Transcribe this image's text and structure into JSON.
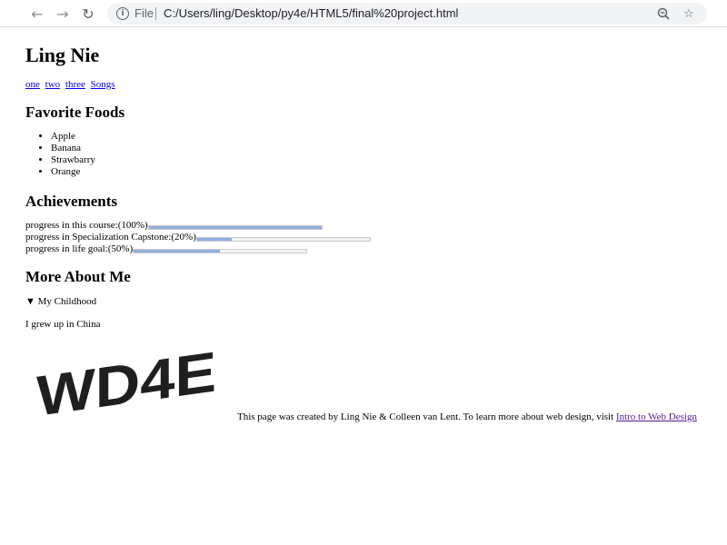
{
  "browser": {
    "scheme_label": "File",
    "url": "C:/Users/ling/Desktop/py4e/HTML5/final%20project.html",
    "back_icon": "arrow-left-icon",
    "forward_icon": "arrow-right-icon",
    "reload_icon": "reload-icon",
    "info_icon": "info-icon",
    "zoom_icon": "zoom-out-icon",
    "star_icon": "star-icon"
  },
  "page": {
    "title": "Ling Nie",
    "nav_links": [
      "one",
      "two",
      "three",
      "Songs"
    ],
    "foods": {
      "heading": "Favorite Foods",
      "items": [
        "Apple",
        "Banana",
        "Strawbarry",
        "Orange"
      ]
    },
    "achievements": {
      "heading": "Achievements",
      "rows": [
        {
          "label": "progress in this course:(100%)",
          "value": 100
        },
        {
          "label": "progress in Specialization Capstone:(20%)",
          "value": 20
        },
        {
          "label": "progress in life goal:(50%)",
          "value": 50
        }
      ]
    },
    "about": {
      "heading": "More About Me",
      "summary": "▼ My Childhood",
      "text": "I grew up in China"
    },
    "logo_text": "WD4E",
    "footer": {
      "text": "This page was created by Ling Nie & Colleen van Lent. To learn more about web design, visit ",
      "link": "Intro to Web Design"
    }
  },
  "colors": {
    "progress_fill": "#8fb0e0",
    "link": "#0000ee",
    "visited_link": "#551a8b"
  }
}
